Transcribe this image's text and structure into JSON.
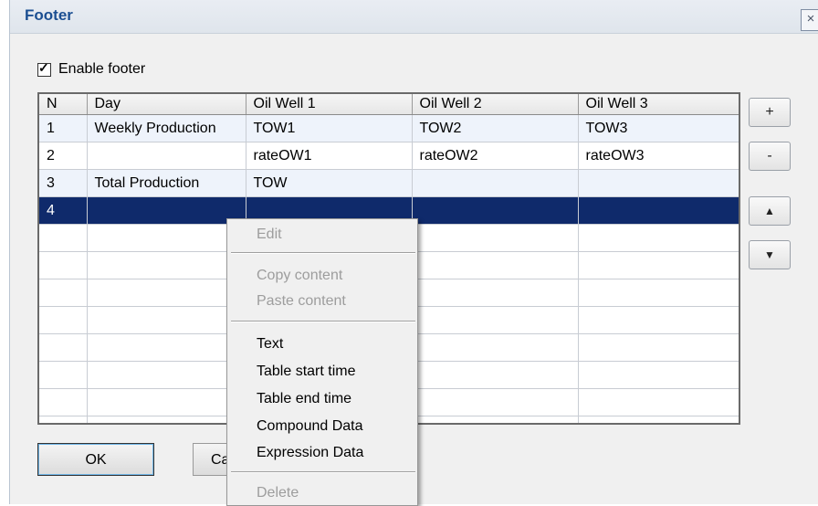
{
  "window": {
    "title": "Footer",
    "close_glyph": "×"
  },
  "enable_footer": {
    "label": "Enable footer",
    "checked": true,
    "tick": "✓"
  },
  "table": {
    "columns": [
      "N",
      "Day",
      "Oil Well 1",
      "Oil Well 2",
      "Oil Well 3"
    ],
    "rows": [
      [
        "1",
        "Weekly Production",
        "TOW1",
        "TOW2",
        "TOW3"
      ],
      [
        "2",
        "",
        "rateOW1",
        "rateOW2",
        "rateOW3"
      ],
      [
        "3",
        "Total Production",
        "TOW",
        "",
        ""
      ],
      [
        "4",
        "",
        "",
        "",
        ""
      ]
    ],
    "selected_row": 4
  },
  "side_buttons": {
    "add": "+",
    "remove": "-",
    "up": "▲",
    "down": "▼"
  },
  "buttons": {
    "ok": "OK",
    "cancel": "Can"
  },
  "context_menu": {
    "edit": "Edit",
    "copy_content": "Copy content",
    "paste_content": "Paste content",
    "text": "Text",
    "table_start_time": "Table start time",
    "table_end_time": "Table end time",
    "compound_data": "Compound Data",
    "expression_data": "Expression Data",
    "delete": "Delete"
  },
  "colors": {
    "selection": "#0f2a6b",
    "title": "#1c4f92",
    "disabled": "#9d9d9d"
  }
}
